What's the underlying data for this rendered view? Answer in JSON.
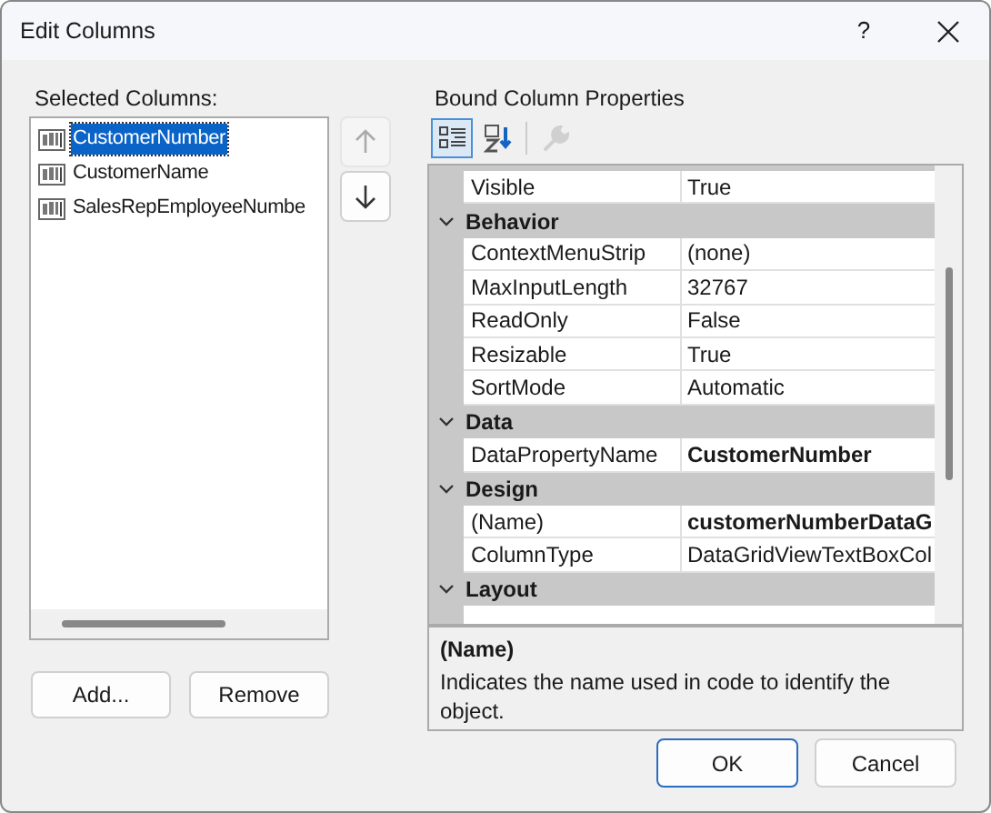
{
  "window": {
    "title": "Edit Columns",
    "help": "?"
  },
  "selected_columns": {
    "label": "Selected Columns:",
    "items": [
      {
        "label": "CustomerNumber",
        "selected": true
      },
      {
        "label": "CustomerName",
        "selected": false
      },
      {
        "label": "SalesRepEmployeeNumbe",
        "selected": false
      }
    ]
  },
  "move_buttons": [
    {
      "kind": "up",
      "disabled": true
    },
    {
      "kind": "down",
      "disabled": false
    }
  ],
  "list_buttons": [
    "Add...",
    "Remove"
  ],
  "properties": {
    "label": "Bound Column Properties",
    "toolbar": [
      {
        "kind": "categorized",
        "selected": true,
        "disabled": false
      },
      {
        "kind": "alphabetical",
        "selected": false,
        "disabled": false
      },
      {
        "kind": "property-pages",
        "selected": false,
        "disabled": true
      }
    ],
    "rows": [
      {
        "kind": "property",
        "name": "Visible",
        "value": "True",
        "bold": false
      },
      {
        "kind": "category",
        "name": "Behavior",
        "expanded": true
      },
      {
        "kind": "property",
        "name": "ContextMenuStrip",
        "value": "(none)",
        "bold": false
      },
      {
        "kind": "property",
        "name": "MaxInputLength",
        "value": "32767",
        "bold": false
      },
      {
        "kind": "property",
        "name": "ReadOnly",
        "value": "False",
        "bold": false
      },
      {
        "kind": "property",
        "name": "Resizable",
        "value": "True",
        "bold": false
      },
      {
        "kind": "property",
        "name": "SortMode",
        "value": "Automatic",
        "bold": false
      },
      {
        "kind": "category",
        "name": "Data",
        "expanded": true
      },
      {
        "kind": "property",
        "name": "DataPropertyName",
        "value": "CustomerNumber",
        "bold": true
      },
      {
        "kind": "category",
        "name": "Design",
        "expanded": true
      },
      {
        "kind": "property",
        "name": "(Name)",
        "value": "customerNumberDataG",
        "bold": true
      },
      {
        "kind": "property",
        "name": "ColumnType",
        "value": "DataGridViewTextBoxCol",
        "bold": false
      },
      {
        "kind": "category",
        "name": "Layout",
        "expanded": true
      },
      {
        "kind": "partial"
      }
    ],
    "description": {
      "title": "(Name)",
      "text": "Indicates the name used in code to identify the object."
    }
  },
  "buttons": [
    "OK",
    "Cancel"
  ]
}
